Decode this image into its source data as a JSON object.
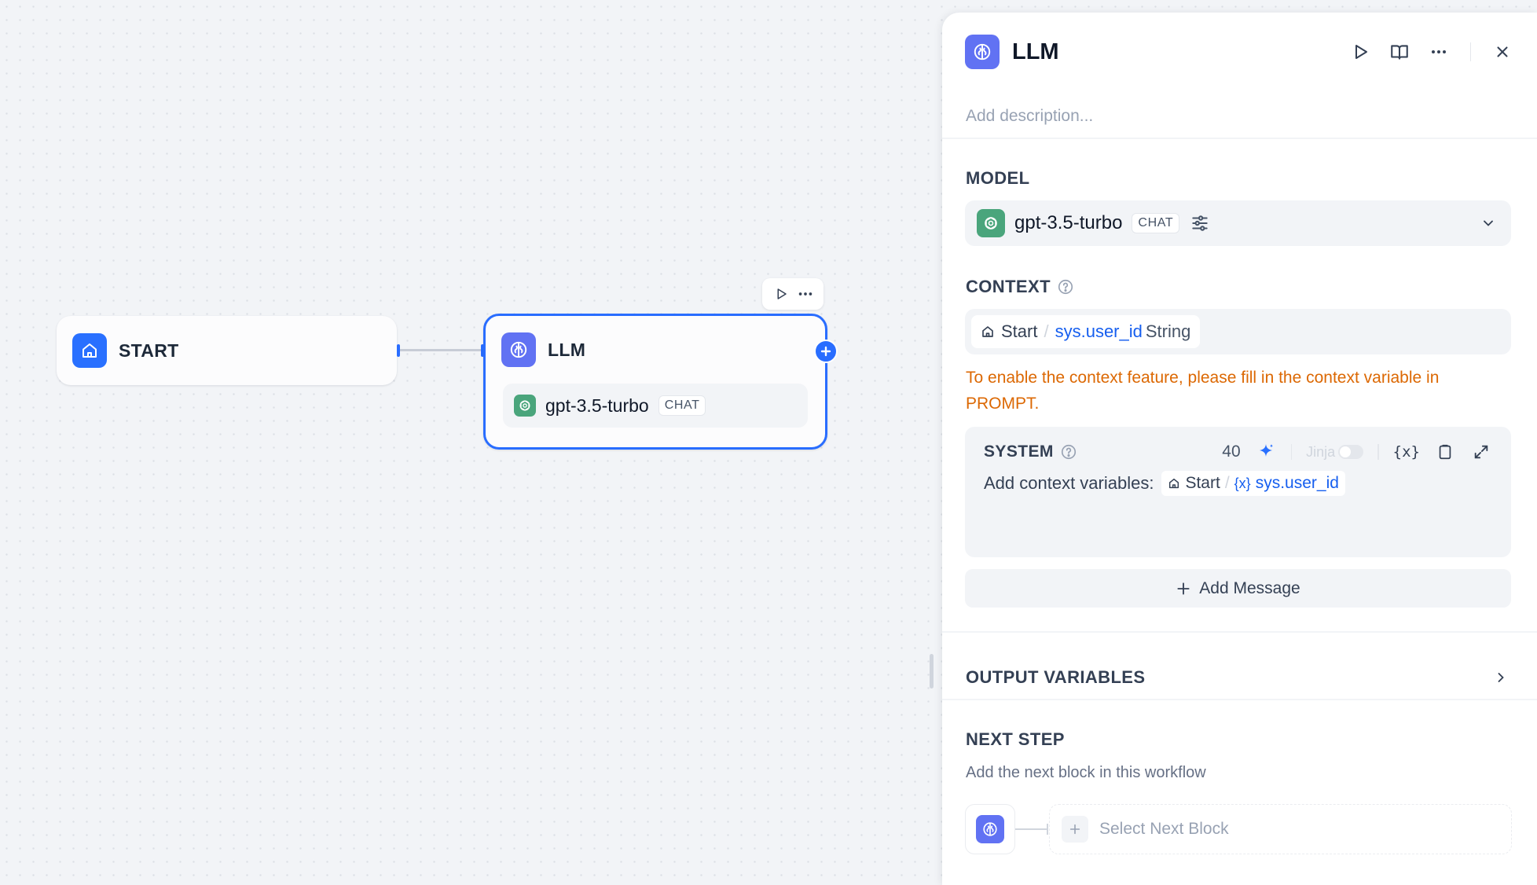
{
  "canvas": {
    "start_node": {
      "title": "START",
      "icon": "home-icon"
    },
    "llm_node": {
      "title": "LLM",
      "model": "gpt-3.5-turbo",
      "mode_badge": "CHAT"
    }
  },
  "panel": {
    "title": "LLM",
    "description_placeholder": "Add description...",
    "model": {
      "label": "MODEL",
      "name": "gpt-3.5-turbo",
      "mode_badge": "CHAT"
    },
    "context": {
      "label": "CONTEXT",
      "node_ref": "Start",
      "separator": "/",
      "variable": "sys.user_id",
      "type": "String",
      "warning": "To enable the context feature, please fill in the context variable in PROMPT."
    },
    "system": {
      "label": "SYSTEM",
      "token_count": "40",
      "jinja_label": "Jinja",
      "content_prefix": "Add context variables:",
      "ctx_node": "Start",
      "ctx_separator": "/",
      "ctx_var_icon": "{x}",
      "ctx_var": "sys.user_id",
      "var_insert_label": "{x}"
    },
    "add_message": "Add Message",
    "output_variables": "OUTPUT VARIABLES",
    "next_step": {
      "label": "NEXT STEP",
      "description": "Add the next block in this workflow",
      "select_label": "Select Next Block"
    }
  },
  "colors": {
    "accent": "#296dff",
    "block_icon": "#6172f3",
    "openai": "#4aa57c",
    "warning": "#dc6803",
    "variable": "#155eef"
  }
}
